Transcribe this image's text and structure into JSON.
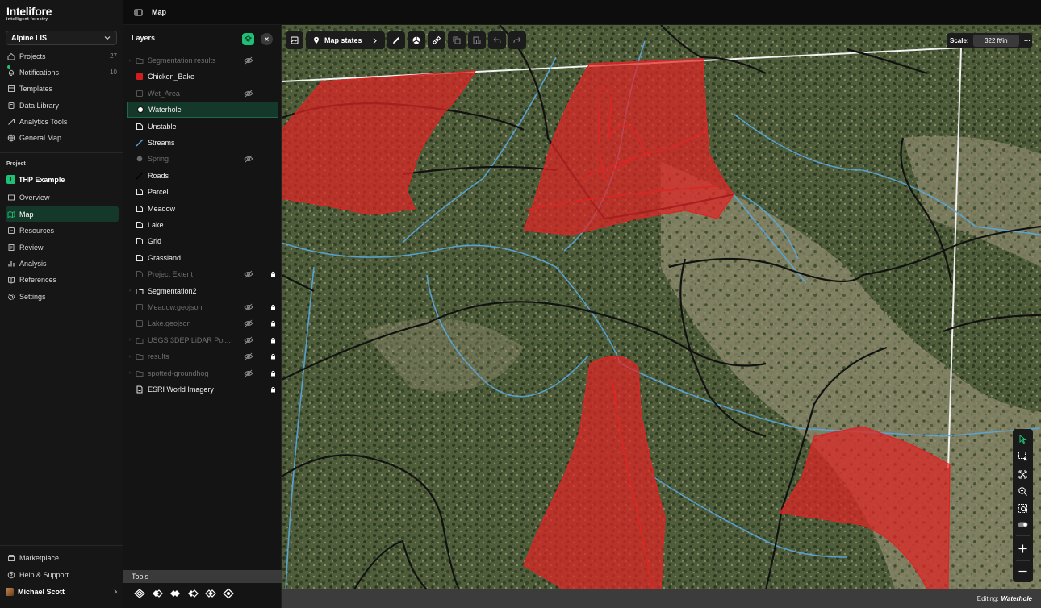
{
  "app": {
    "brand": "Intelifore",
    "tagline": "intelligent forestry",
    "org": "Alpine LIS"
  },
  "nav": {
    "main": [
      {
        "label": "Projects",
        "count": "27",
        "icon": "projects-icon"
      },
      {
        "label": "Notifications",
        "count": "10",
        "icon": "bell-icon"
      },
      {
        "label": "Templates",
        "icon": "templates-icon"
      },
      {
        "label": "Data Library",
        "icon": "database-icon"
      },
      {
        "label": "Analytics Tools",
        "icon": "analytics-icon"
      },
      {
        "label": "General Map",
        "icon": "globe-icon"
      }
    ],
    "project_section": "Project",
    "project_badge": "T",
    "project_name": "THP Example",
    "project_items": [
      {
        "label": "Overview",
        "icon": "overview-icon"
      },
      {
        "label": "Map",
        "icon": "map-icon",
        "active": true
      },
      {
        "label": "Resources",
        "icon": "resources-icon"
      },
      {
        "label": "Review",
        "icon": "review-icon"
      },
      {
        "label": "Analysis",
        "icon": "chart-icon"
      },
      {
        "label": "References",
        "icon": "book-icon"
      },
      {
        "label": "Settings",
        "icon": "gear-icon"
      }
    ],
    "bottom": [
      {
        "label": "Marketplace",
        "icon": "store-icon"
      },
      {
        "label": "Help & Support",
        "icon": "help-icon"
      }
    ],
    "user": "Michael Scott"
  },
  "topbar": {
    "title": "Map"
  },
  "layers": {
    "title": "Layers",
    "items": [
      {
        "label": "Segmentation results",
        "symbol": "folder",
        "dim": true,
        "hidden": true,
        "caret": true
      },
      {
        "label": "Chicken_Bake",
        "symbol": "red-fill"
      },
      {
        "label": "Wet_Area",
        "symbol": "square",
        "dim": true,
        "hidden": true
      },
      {
        "label": "Waterhole",
        "symbol": "dot",
        "active": true
      },
      {
        "label": "Unstable",
        "symbol": "polygon"
      },
      {
        "label": "Streams",
        "symbol": "blue-line"
      },
      {
        "label": "Spring",
        "symbol": "grey-dot",
        "dim": true,
        "hidden": true
      },
      {
        "label": "Roads",
        "symbol": "black-line"
      },
      {
        "label": "Parcel",
        "symbol": "polygon"
      },
      {
        "label": "Meadow",
        "symbol": "polygon"
      },
      {
        "label": "Lake",
        "symbol": "polygon"
      },
      {
        "label": "Grid",
        "symbol": "polygon"
      },
      {
        "label": "Grassland",
        "symbol": "polygon"
      },
      {
        "label": "Project Extent",
        "symbol": "polygon",
        "dim": true,
        "hidden": true,
        "locked": true
      },
      {
        "label": "Segmentation2",
        "symbol": "folder",
        "caret": true
      },
      {
        "label": "Meadow.geojson",
        "symbol": "square",
        "dim": true,
        "hidden": true,
        "locked": true
      },
      {
        "label": "Lake.geojson",
        "symbol": "square",
        "dim": true,
        "hidden": true,
        "locked": true
      },
      {
        "label": "USGS 3DEP LiDAR Poi...",
        "symbol": "folder",
        "dim": true,
        "hidden": true,
        "locked": true,
        "caret": true
      },
      {
        "label": "results",
        "symbol": "folder",
        "dim": true,
        "hidden": true,
        "locked": true,
        "caret": true
      },
      {
        "label": "spotted-groundhog",
        "symbol": "folder",
        "dim": true,
        "hidden": true,
        "locked": true,
        "caret": true
      },
      {
        "label": "ESRI World Imagery",
        "symbol": "doc",
        "locked": true
      }
    ],
    "tools_title": "Tools"
  },
  "map": {
    "map_states_label": "Map states",
    "scale_label": "Scale:",
    "scale_value": "322 ft/in",
    "colors": {
      "polygon": "#e02424",
      "stream": "#5aa9e0",
      "road": "#111111",
      "accent": "#1fbf75"
    }
  },
  "status": {
    "editing_label": "Editing:",
    "editing_layer": "Waterhole"
  }
}
